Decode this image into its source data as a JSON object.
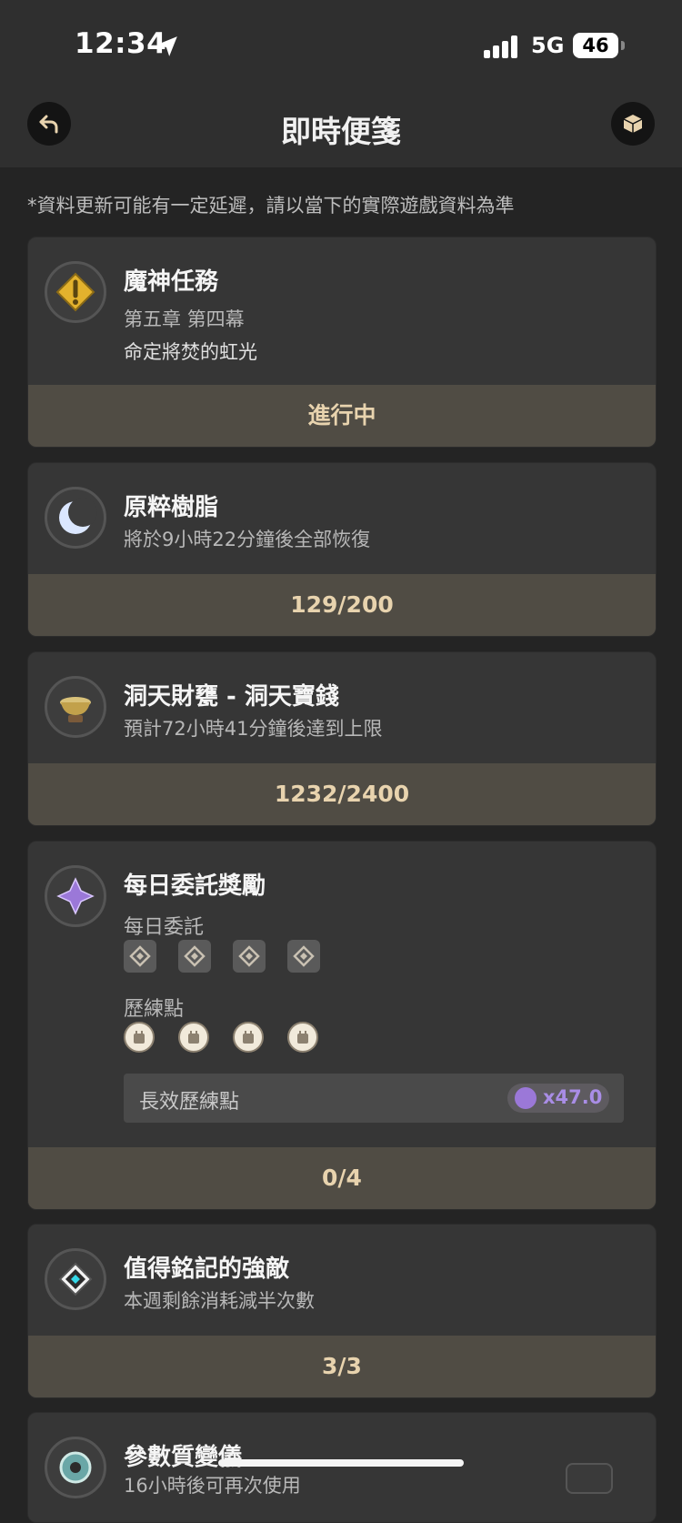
{
  "status_bar": {
    "time": "12:34",
    "network": "5G",
    "battery": "46"
  },
  "nav": {
    "title": "即時便箋",
    "back_icon": "back-arrow-icon",
    "gift_icon": "gift-box-icon"
  },
  "notice": "*資料更新可能有一定延遲，請以當下的實際遊戲資料為準",
  "cards": {
    "archon": {
      "title": "魔神任務",
      "line1": "第五章 第四幕",
      "line2": "命定將焚的虹光",
      "status": "進行中"
    },
    "resin": {
      "title": "原粹樹脂",
      "subtitle": "將於9小時22分鐘後全部恢復",
      "value": "129/200"
    },
    "realm": {
      "title": "洞天財甕 - 洞天寶錢",
      "subtitle": "預計72小時41分鐘後達到上限",
      "value": "1232/2400"
    },
    "daily": {
      "title": "每日委託獎勵",
      "commission_label": "每日委託",
      "encounter_label": "歷練點",
      "extra_label": "長效歷練點",
      "extra_value": "x47.0",
      "value": "0/4"
    },
    "weekly": {
      "title": "值得銘記的強敵",
      "subtitle": "本週剩餘消耗減半次數",
      "value": "3/3"
    },
    "transformer": {
      "title": "參數質變儀",
      "subtitle": "16小時後可再次使用"
    }
  },
  "colors": {
    "accent_gold": "#e8d3ae",
    "footer_bg": "#504c44",
    "card_bg": "#363636",
    "purple": "#9b78d8"
  }
}
